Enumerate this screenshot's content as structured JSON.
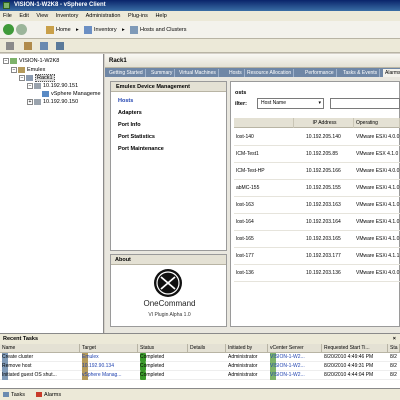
{
  "window": {
    "title": "VISION-1-W2K8 - vSphere Client"
  },
  "menu": [
    "File",
    "Edit",
    "View",
    "Inventory",
    "Administration",
    "Plug-ins",
    "Help"
  ],
  "nav": {
    "home": "Home",
    "inventory": "Inventory",
    "location": "Hosts and Clusters"
  },
  "tree": {
    "root": "VISION-1-W2K8",
    "datacenter": "Emulex",
    "cluster": "Rack1",
    "host1": "10.192.90.151",
    "vm1": "vSphere Manageme",
    "host2": "10.192.90.150"
  },
  "panel": {
    "title": "Rack1"
  },
  "tabs": [
    "Getting Started",
    "Summary",
    "Virtual Machines",
    "Hosts",
    "Resource Allocation",
    "Performance",
    "Tasks & Events",
    "Alarms"
  ],
  "emulex_nav": {
    "header": "Emulex Device Management",
    "items": [
      "Hosts",
      "Adapters",
      "Port Info",
      "Port Statistics",
      "Port Maintenance"
    ]
  },
  "about": {
    "header": "About",
    "product": "OneCommand",
    "subtitle": "VI Plugin Alpha 1.0"
  },
  "hosts_panel": {
    "title": "osts",
    "filter_label": "ilter:",
    "filter_value": "Host Name",
    "columns": [
      "",
      "IP Address",
      "Operating"
    ],
    "rows": [
      {
        "name": "lost-140",
        "ip": "10.192.205.140",
        "os": "VMware ESXi 4.0.0"
      },
      {
        "name": "ICM-Test1",
        "ip": "10.192.205.85",
        "os": "VMware ESX 4.1.0"
      },
      {
        "name": "ICM-Test-HP",
        "ip": "10.192.205.166",
        "os": "VMware ESXi 4.0.0"
      },
      {
        "name": "abMC-155",
        "ip": "10.192.205.155",
        "os": "VMware ESXi 4.1.0"
      },
      {
        "name": "lost-163",
        "ip": "10.192.203.163",
        "os": "VMware ESXi 4.1.0"
      },
      {
        "name": "lost-164",
        "ip": "10.192.203.164",
        "os": "VMware ESXi 4.1.0"
      },
      {
        "name": "lost-165",
        "ip": "10.192.203.165",
        "os": "VMware ESXi 4.1.0"
      },
      {
        "name": "lost-177",
        "ip": "10.192.203.177",
        "os": "VMware ESXi 4.1.1"
      },
      {
        "name": "lost-136",
        "ip": "10.192.203.136",
        "os": "VMware ESXi 4.0.0"
      }
    ]
  },
  "recent_tasks": {
    "title": "Recent Tasks",
    "close": "×",
    "columns": [
      "Name",
      "Target",
      "Status",
      "Details",
      "Initiated by",
      "vCenter Server",
      "Requested Start Ti...",
      "Sta"
    ],
    "rows": [
      {
        "name": "Create cluster",
        "target": "Emulex",
        "status": "Completed",
        "initiated": "Administrator",
        "server": "VISION-1-W2...",
        "time": "8/20/2010 4:49:46 PM",
        "start": "8/2"
      },
      {
        "name": "Remove host",
        "target": "10.192.90.134",
        "status": "Completed",
        "initiated": "Administrator",
        "server": "VISION-1-W2...",
        "time": "8/20/2010 4:49:31 PM",
        "start": "8/2"
      },
      {
        "name": "Initiated guest OS shut...",
        "target": "vSphere Manag...",
        "status": "Completed",
        "initiated": "Administrator",
        "server": "VISION-1-W2...",
        "time": "8/20/2010 4:44:04 PM",
        "start": "8/2"
      }
    ]
  },
  "statusbar": {
    "tasks": "Tasks",
    "alarms": "Alarms"
  },
  "colors": {
    "titlebar": "#0a246a",
    "tabs": "#6f87a6",
    "link": "#2143b0",
    "status_ok": "#3a9a2a"
  }
}
